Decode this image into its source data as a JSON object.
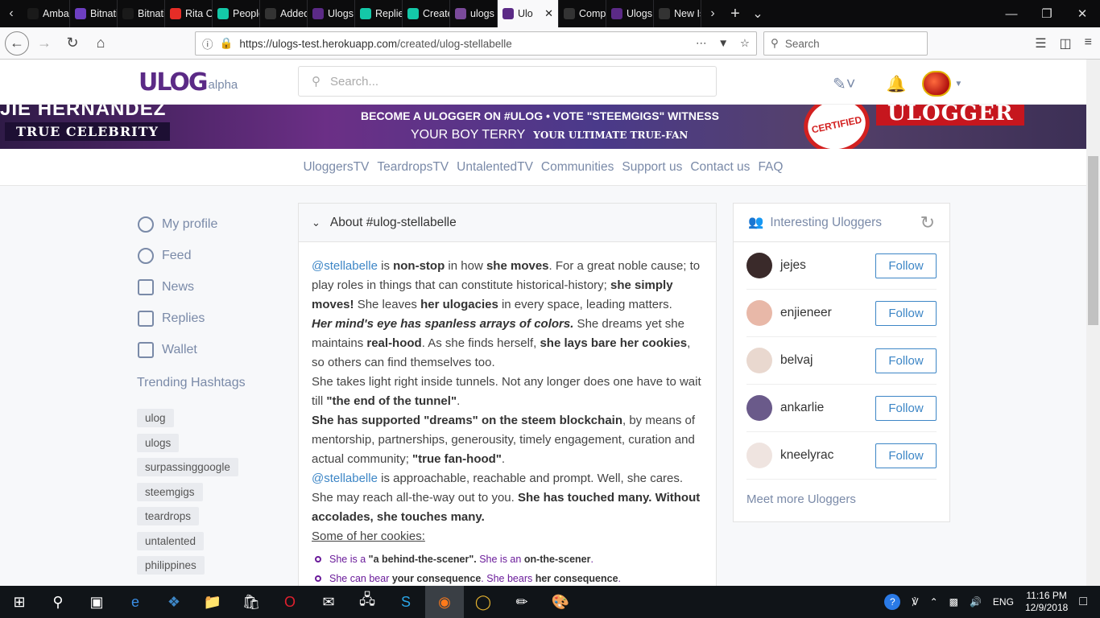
{
  "browser": {
    "tabs": [
      {
        "label": "Amba",
        "color": "#1a1a1a"
      },
      {
        "label": "Bitnati",
        "color": "#6d3fc1"
      },
      {
        "label": "Bitnati",
        "color": "#1a1a1a"
      },
      {
        "label": "Rita O",
        "color": "#e52d27"
      },
      {
        "label": "People",
        "color": "#14c8a8"
      },
      {
        "label": "Added",
        "color": "#333333"
      },
      {
        "label": "Ulogs",
        "color": "#5b2a86"
      },
      {
        "label": "Replie",
        "color": "#14c8a8"
      },
      {
        "label": "Create",
        "color": "#14c8a8"
      },
      {
        "label": "ulogs",
        "color": "#7a4a9a"
      },
      {
        "label": "Ulo",
        "color": "#5b2a86",
        "active": true
      },
      {
        "label": "Comp",
        "color": "#333333"
      },
      {
        "label": "Ulogs",
        "color": "#5b2a86"
      },
      {
        "label": "New Is",
        "color": "#333333"
      }
    ],
    "url": {
      "host": "https://ulogs-test.herokuapp.com",
      "path": "/created/ulog-stellabelle"
    },
    "search_placeholder": "Search"
  },
  "site": {
    "logo": "ULOG",
    "alpha": "alpha",
    "search_placeholder": "Search..."
  },
  "banner": {
    "left_name": "JIE HERNANDEZ",
    "left_tag": "TRUE CELEBRITY",
    "line1": "BECOME A ULOGGER ON #ULOG • VOTE \"STEEMGIGS\" WITNESS",
    "line2": "YOUR BOY TERRY",
    "line2b": "YOUR ULTIMATE TRUE-FAN",
    "stamp": "CERTIFIED",
    "ulogger": "ULOGGER"
  },
  "toplinks": [
    "UloggersTV",
    "TeardropsTV",
    "UntalentedTV",
    "Communities",
    "Support us",
    "Contact us",
    "FAQ"
  ],
  "leftnav": [
    {
      "label": "My profile",
      "icon": "user-circle-icon"
    },
    {
      "label": "Feed",
      "icon": "alarm-clock-icon"
    },
    {
      "label": "News",
      "icon": "newspaper-icon"
    },
    {
      "label": "Replies",
      "icon": "comment-icon"
    },
    {
      "label": "Wallet",
      "icon": "wallet-icon"
    }
  ],
  "trending": {
    "title": "Trending Hashtags",
    "tags": [
      "ulog",
      "ulogs",
      "surpassinggoogle",
      "steemgigs",
      "teardrops",
      "untalented",
      "philippines"
    ]
  },
  "about": {
    "title": "About #ulog-stellabelle",
    "p1": {
      "mention": "@stellabelle",
      "t1": " is ",
      "b1": "non-stop",
      "t2": " in how ",
      "b2": "she moves",
      "t3": ". For a great noble cause; to play roles in things that can constitute historical-history; ",
      "b3": "she simply moves!",
      "t4": " She leaves ",
      "b4": "her ulogacies",
      "t5": " in every space, leading matters."
    },
    "p2": {
      "bi": "Her mind's eye has spanless arrays of colors.",
      "t1": " She dreams yet she maintains ",
      "b1": "real-hood",
      "t2": ". As she finds herself, ",
      "b2": "she lays bare her cookies",
      "t3": ", so others can find themselves too."
    },
    "p3": {
      "t1": "She takes light right inside tunnels. Not any longer does one have to wait till ",
      "b1": "\"the end of the tunnel\"",
      "t2": "."
    },
    "p4": {
      "b1": "She has supported \"dreams\" on the steem blockchain",
      "t1": ", by means of mentorship, partnerships, generousity, timely engagement, curation and actual community; ",
      "b2": "\"true fan-hood\"",
      "t2": "."
    },
    "p5": {
      "mention": "@stellabelle",
      "t1": " is approachable, reachable and prompt. Well, she cares. She may reach all-the-way out to you. ",
      "b1": "She has touched many. Without accolades, she touches many."
    },
    "cookies_label": "Some of her cookies:",
    "cookies": [
      {
        "t1": "She is a ",
        "b1": "\"a behind-the-scener\".",
        "t2": " She is an ",
        "b2": "on-the-scener",
        "t3": "."
      },
      {
        "t1": "She can bear ",
        "b1": "your consequence",
        "t2": ". She bears ",
        "b2": "her consequence",
        "t3": "."
      }
    ]
  },
  "uloggers": {
    "title": "Interesting Uloggers",
    "follow_label": "Follow",
    "users": [
      {
        "name": "jejes",
        "color": "#3a2a2a"
      },
      {
        "name": "enjieneer",
        "color": "#e8b8a8"
      },
      {
        "name": "belvaj",
        "color": "#e9d8cf"
      },
      {
        "name": "ankarlie",
        "color": "#6a5a8a"
      },
      {
        "name": "kneelyrac",
        "color": "#efe4e0"
      }
    ],
    "more": "Meet more Uloggers"
  },
  "taskbar": {
    "lang": "ENG",
    "time": "11:16 PM",
    "date": "12/9/2018"
  }
}
